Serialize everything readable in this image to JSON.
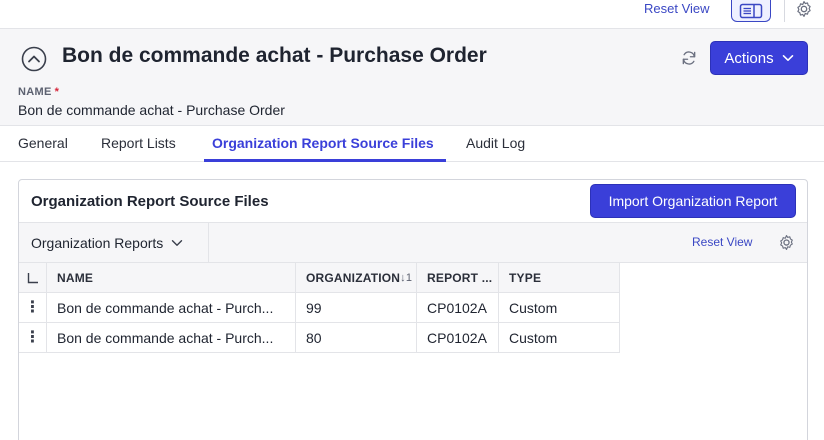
{
  "topbar": {
    "reset_view": "Reset View",
    "icons": [
      "panel-toggle-icon",
      "gear-icon"
    ]
  },
  "header": {
    "title": "Bon de commande achat - Purchase Order",
    "actions_label": "Actions",
    "name_label": "NAME",
    "required_marker": "*",
    "name_value": "Bon de commande achat - Purchase Order",
    "icons": [
      "collapse-icon",
      "refresh-icon",
      "chevron-down-icon"
    ]
  },
  "tabs": [
    "General",
    "Report Lists",
    "Organization Report Source Files",
    "Audit Log"
  ],
  "active_tab": "Organization Report Source Files",
  "panel": {
    "title": "Organization Report Source Files",
    "import_label": "Import Organization Report",
    "view_name": "Organization Reports",
    "reset_view": "Reset View"
  },
  "table": {
    "columns": [
      "NAME",
      "ORGANIZATION",
      "REPORT ...",
      "TYPE"
    ],
    "sort_indicator": "↓1",
    "rows": [
      {
        "name": "Bon de commande achat - Purch...",
        "organization": "99",
        "report": "CP0102A",
        "type": "Custom"
      },
      {
        "name": "Bon de commande achat - Purch...",
        "organization": "80",
        "report": "CP0102A",
        "type": "Custom"
      }
    ]
  },
  "colors": {
    "accent": "#3a3fd9",
    "link": "#3a47c4",
    "required": "#d6263b",
    "header_bg": "#f6f6f8"
  }
}
